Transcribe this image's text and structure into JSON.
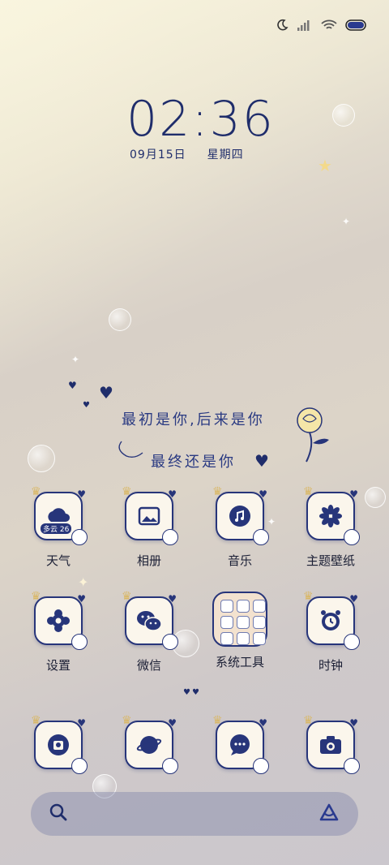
{
  "status_bar": {
    "icons": [
      "moon-icon",
      "signal-icon",
      "wifi-icon",
      "battery-icon"
    ]
  },
  "clock": {
    "time": "02:36",
    "date": "09月15日",
    "weekday": "星期四"
  },
  "quote": {
    "line1": "最初是你,后来是你",
    "line2": "最终还是你"
  },
  "apps_row1": [
    {
      "label": "天气",
      "icon": "weather-icon",
      "badge": "多云 26"
    },
    {
      "label": "相册",
      "icon": "gallery-icon"
    },
    {
      "label": "音乐",
      "icon": "music-icon"
    },
    {
      "label": "主题壁纸",
      "icon": "theme-icon"
    }
  ],
  "apps_row2": [
    {
      "label": "设置",
      "icon": "settings-icon"
    },
    {
      "label": "微信",
      "icon": "wechat-icon"
    },
    {
      "label": "系统工具",
      "icon": "folder-icon"
    },
    {
      "label": "时钟",
      "icon": "alarm-clock-icon"
    }
  ],
  "dock": [
    {
      "icon": "phone-icon"
    },
    {
      "icon": "browser-icon"
    },
    {
      "icon": "messages-icon"
    },
    {
      "icon": "camera-icon"
    }
  ],
  "colors": {
    "accent": "#27357a",
    "text": "#1b1f35"
  }
}
